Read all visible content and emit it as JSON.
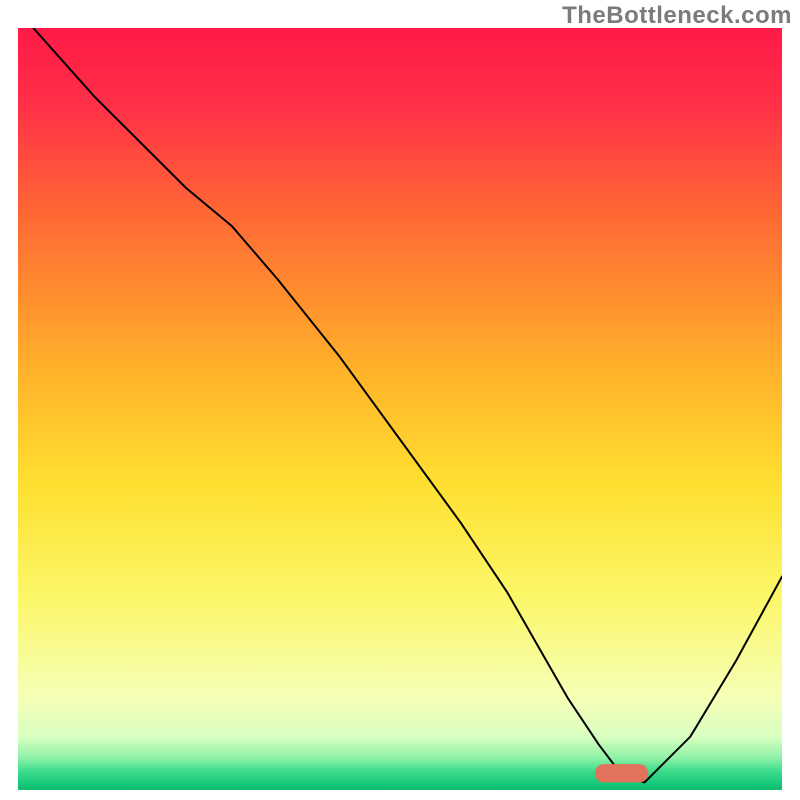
{
  "attribution": "TheBottleneck.com",
  "chart_data": {
    "type": "line",
    "title": "",
    "xlabel": "",
    "ylabel": "",
    "xlim": [
      0,
      100
    ],
    "ylim": [
      0,
      100
    ],
    "background_gradient": {
      "stops": [
        {
          "offset": 0.0,
          "color": "#ff1a47"
        },
        {
          "offset": 0.1,
          "color": "#ff2f47"
        },
        {
          "offset": 0.25,
          "color": "#ff6a34"
        },
        {
          "offset": 0.45,
          "color": "#ffb22a"
        },
        {
          "offset": 0.6,
          "color": "#ffe030"
        },
        {
          "offset": 0.75,
          "color": "#fbf76a"
        },
        {
          "offset": 0.88,
          "color": "#f6ffb8"
        },
        {
          "offset": 0.93,
          "color": "#d8ffc0"
        },
        {
          "offset": 0.958,
          "color": "#8ef2a8"
        },
        {
          "offset": 0.975,
          "color": "#3fdc8c"
        },
        {
          "offset": 0.992,
          "color": "#17c97a"
        },
        {
          "offset": 1.0,
          "color": "#0dba6d"
        }
      ]
    },
    "series": [
      {
        "name": "bottleneck-curve",
        "color": "#000000",
        "width": 2,
        "x": [
          2,
          10,
          22,
          28,
          34,
          42,
          50,
          58,
          64,
          68,
          72,
          76,
          79,
          82,
          88,
          94,
          100
        ],
        "y": [
          100,
          91,
          79,
          74,
          67,
          57,
          46,
          35,
          26,
          19,
          12,
          6,
          2,
          1,
          7,
          17,
          28
        ]
      }
    ],
    "marker": {
      "name": "optimal-range",
      "shape": "capsule",
      "color": "#e2725b",
      "x_center": 79,
      "y_center": 2.2,
      "width_x": 7,
      "height_y": 2.4
    }
  }
}
